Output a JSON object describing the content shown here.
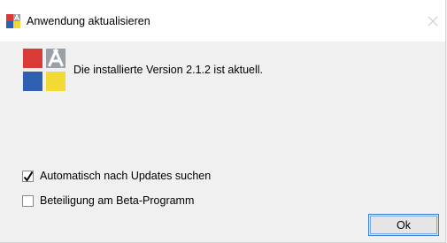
{
  "window": {
    "title": "Anwendung aktualisieren",
    "close_glyph": "✕"
  },
  "message": "Die installierte Version 2.1.2 ist aktuell.",
  "options": [
    {
      "label": "Automatisch nach Updates suchen",
      "checked": true
    },
    {
      "label": "Beteiligung am Beta-Programm",
      "checked": false
    }
  ],
  "buttons": {
    "ok_label": "Ok"
  },
  "icons": {
    "title_icon": "app-logo-icon",
    "app_icon": "app-logo-icon",
    "close_icon": "close-icon",
    "check_icon": "checkmark-icon"
  },
  "colors": {
    "logo_red": "#d93a36",
    "logo_gray": "#9aa0a8",
    "logo_blue": "#2f5fb0",
    "logo_yellow": "#f2d934",
    "accent_border": "#3d7dd6"
  }
}
